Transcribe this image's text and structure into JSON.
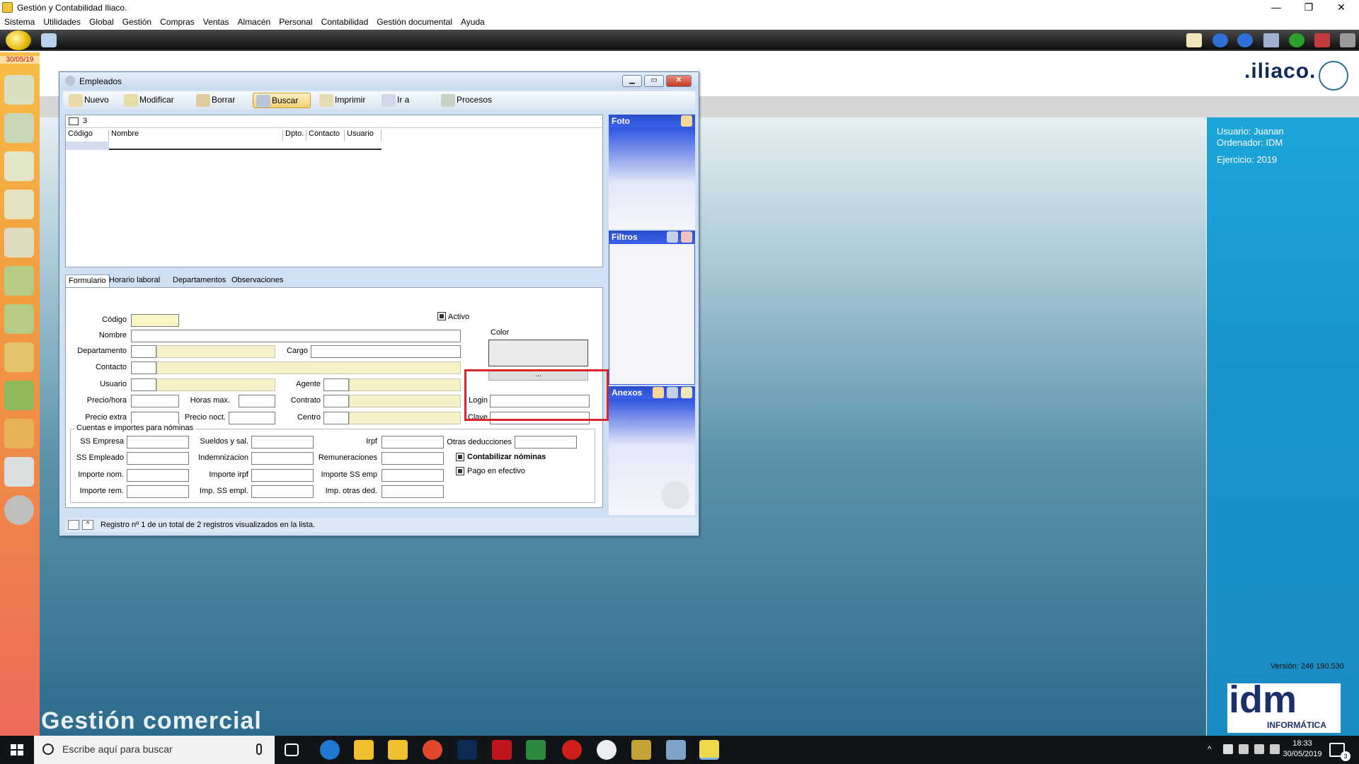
{
  "titlebar": {
    "title": "Gestión y Contabilidad Iliaco.",
    "minimize": "—",
    "restore": "❐",
    "close": "✕"
  },
  "menu": [
    "Sistema",
    "Utilidades",
    "Global",
    "Gestión",
    "Compras",
    "Ventas",
    "Almacén",
    "Personal",
    "Contabilidad",
    "Gestión documental",
    "Ayuda"
  ],
  "leftbar": {
    "date": "30/05/19"
  },
  "brand": {
    "name": ".iliaco."
  },
  "info": {
    "usuario": "Usuario: Juanan",
    "ordenador": "Ordenador: IDM",
    "ejercicio": "Ejercicio: 2019",
    "version": "Versión: 246 190.530"
  },
  "idm": {
    "logo": "idm",
    "sub": "INFORMÁTICA"
  },
  "footer_label": "Gestión comercial",
  "dialog": {
    "title": "Empleados",
    "toolbar": [
      "Nuevo",
      "Modificar",
      "Borrar",
      "Buscar",
      "Imprimir",
      "Ir a",
      "Procesos"
    ],
    "filter_value": "3",
    "columns": [
      "Código",
      "Nombre",
      "Dpto.",
      "Contacto",
      "Usuario"
    ],
    "tabs": [
      "Formulario",
      "Horario laboral",
      "Departamentos",
      "Observaciones"
    ],
    "form": {
      "codigo": "Código",
      "nombre": "Nombre",
      "departamento": "Departamento",
      "cargo": "Cargo",
      "contacto": "Contacto",
      "usuario": "Usuario",
      "agente": "Agente",
      "precio_hora": "Precio/hora",
      "horas_max": "Horas max.",
      "contrato": "Contrato",
      "precio_extra": "Precio extra",
      "precio_noct": "Precio noct.",
      "centro": "Centro",
      "activo": "Activo",
      "color": "Color",
      "color_button": "...",
      "login": "Login",
      "clave": "Clave"
    },
    "nominas": {
      "title": "Cuentas e importes para nóminas",
      "ss_empresa": "SS Empresa",
      "sueldos": "Sueldos y sal.",
      "irpf": "Irpf",
      "otras_ded": "Otras deducciones",
      "ss_empleado": "SS Empleado",
      "indemnizacion": "Indemnizacion",
      "remuneraciones": "Remuneraciones",
      "importe_nom": "Importe nom.",
      "importe_irpf": "Importe irpf",
      "importe_ss_emp": "Importe SS emp",
      "importe_rem": "Importe rem.",
      "imp_ss_empl": "Imp. SS empl.",
      "imp_otras_ded": "Imp. otras ded.",
      "contabilizar": "Contabilizar nóminas",
      "pago_efectivo": "Pago en efectivo"
    },
    "status": "Registro nº 1 de un total de 2 registros visualizados en la lista.",
    "panels": {
      "foto": "Foto",
      "filtros": "Filtros",
      "anexos": "Anexos"
    }
  },
  "taskbar": {
    "search_placeholder": "Escribe aquí para buscar",
    "time": "18:33",
    "date": "30/05/2019",
    "notifications": "3"
  },
  "colors": {
    "highlight": "#d7262b",
    "info_panel": "#1a93cc",
    "panel_header": "#3960e8"
  }
}
